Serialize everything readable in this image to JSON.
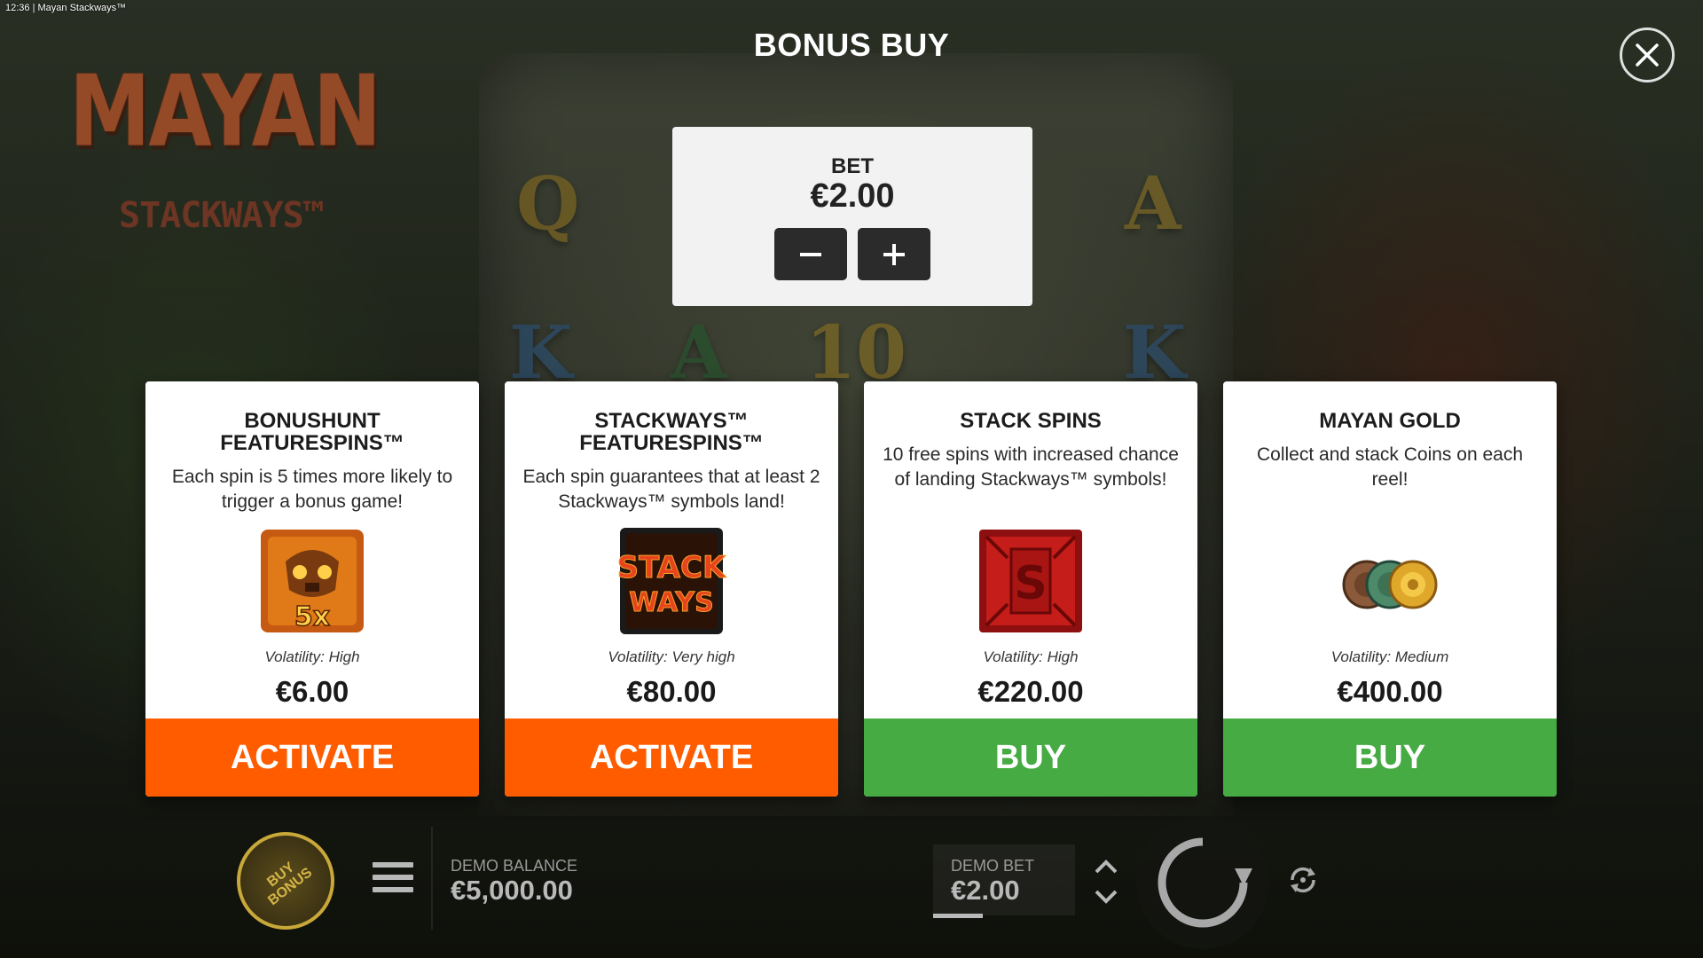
{
  "window": {
    "caption": "12:36  |  Mayan Stackways™"
  },
  "game": {
    "logo_main": "MAYAN",
    "logo_sub": "STACKWAYS™"
  },
  "modal": {
    "title": "BONUS BUY",
    "close_icon": "close-icon"
  },
  "bet_panel": {
    "label": "BET",
    "value": "€2.00",
    "decrease_icon": "minus-icon",
    "increase_icon": "plus-icon"
  },
  "cards": [
    {
      "title": "BONUSHUNT FEATURESPINS™",
      "description": "Each spin is 5 times more likely to trigger a bonus game!",
      "image": "bonushunt-skull-5x-icon",
      "volatility": "Volatility: High",
      "price": "€6.00",
      "action": "ACTIVATE",
      "action_color": "#ff5c00"
    },
    {
      "title": "STACKWAYS™ FEATURESPINS™",
      "description": "Each spin guarantees that at least 2 Stackways™ symbols land!",
      "image": "stackways-logo-icon",
      "volatility": "Volatility: Very high",
      "price": "€80.00",
      "action": "ACTIVATE",
      "action_color": "#ff5c00"
    },
    {
      "title": "STACK SPINS",
      "description": "10 free spins with increased chance of landing Stackways™ symbols!",
      "image": "red-s-stack-icon",
      "volatility": "Volatility: High",
      "price": "€220.00",
      "action": "BUY",
      "action_color": "#45ab42"
    },
    {
      "title": "MAYAN GOLD",
      "description": "Collect and stack Coins on each reel!",
      "image": "coins-icon",
      "volatility": "Volatility: Medium",
      "price": "€400.00",
      "action": "BUY",
      "action_color": "#45ab42"
    }
  ],
  "bottom_bar": {
    "buy_bonus_label": "BUY BONUS",
    "balance_label": "DEMO BALANCE",
    "balance_value": "€5,000.00",
    "bet_label": "DEMO BET",
    "bet_value": "€2.00"
  },
  "reel_symbols": [
    "Q",
    "A",
    "K",
    "A",
    "10",
    "K"
  ]
}
